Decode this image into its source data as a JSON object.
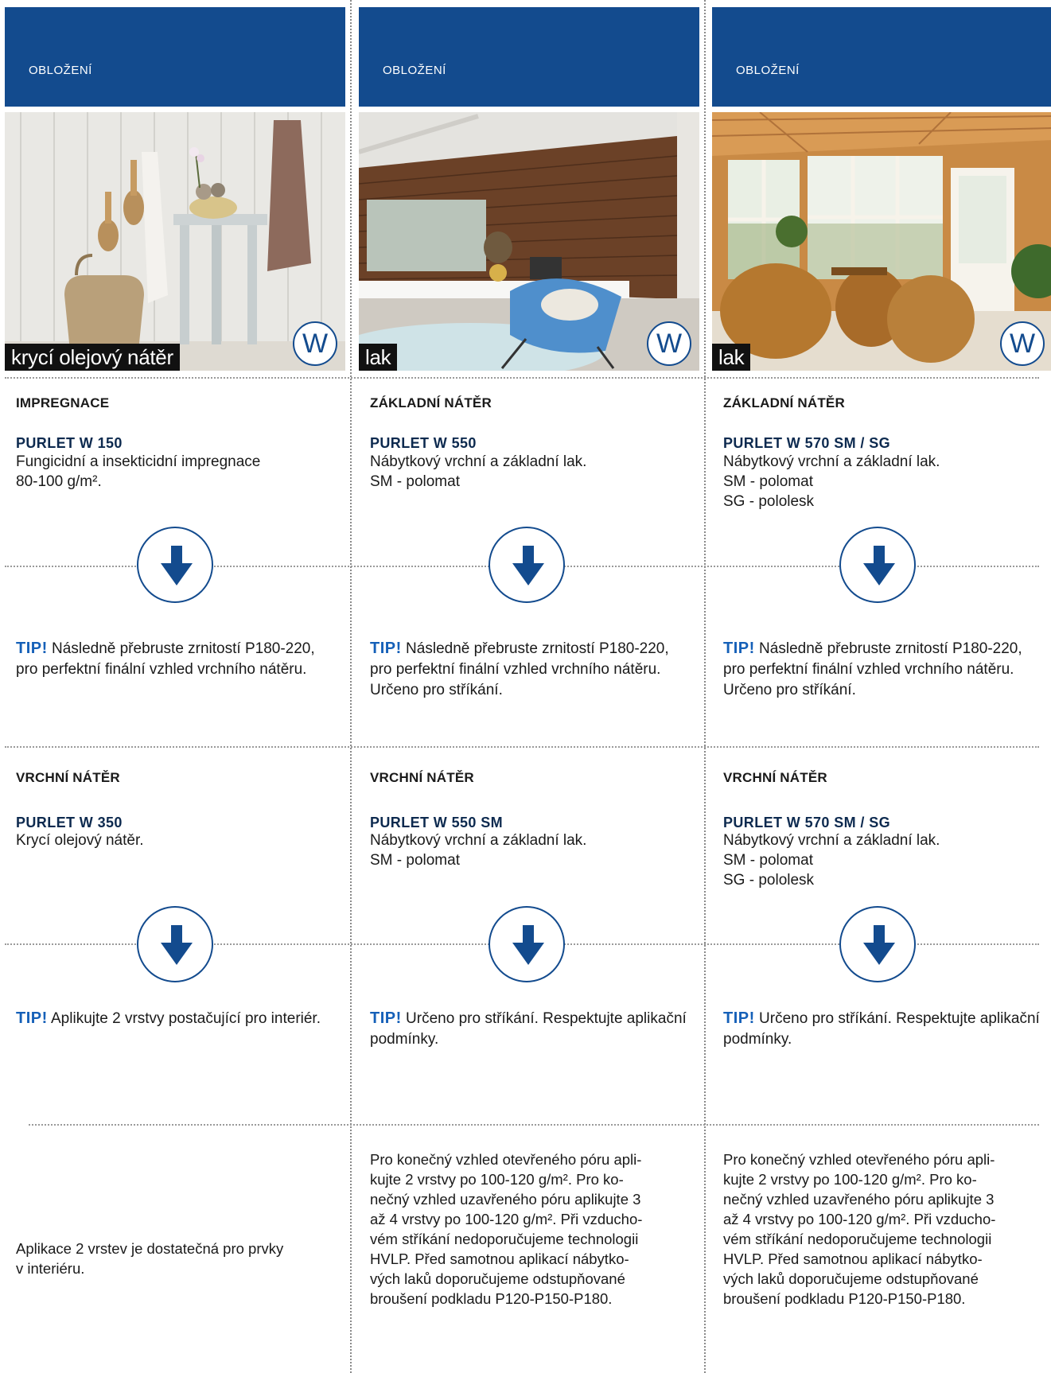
{
  "columns": [
    {
      "header": "OBLOŽENÍ",
      "finish_label": "krycí olejový nátěr",
      "badge": "W",
      "step1": {
        "title": "IMPREGNACE",
        "product": "PURLET W 150",
        "desc": [
          "Fungicidní a insekticidní impregnace",
          "80-100 g/m²."
        ]
      },
      "tip1": {
        "tip_word": "TIP!",
        "text": " Následně přebruste zrnitostí P180-220, pro perfektní finální vzhled vrchního nátěru."
      },
      "step2": {
        "title": "VRCHNÍ NÁTĚR",
        "product": "PURLET W 350",
        "desc": [
          "Krycí olejový  nátěr."
        ]
      },
      "tip2": {
        "tip_word": "TIP!",
        "text": " Aplikujte 2 vrstvy postačující pro interiér."
      },
      "final": [
        "Aplikace 2 vrstev je dostatečná pro prvky",
        "v interiéru."
      ]
    },
    {
      "header": "OBLOŽENÍ",
      "finish_label": "lak",
      "badge": "W",
      "step1": {
        "title": "ZÁKLADNÍ NÁTĚR",
        "product": "PURLET W 550",
        "desc": [
          "Nábytkový vrchní a základní lak.",
          "SM - polomat"
        ]
      },
      "tip1": {
        "tip_word": "TIP!",
        "text": " Následně přebruste zrnitostí P180-220, pro perfektní finální vzhled vrchního nátěru. Určeno pro stříkání."
      },
      "step2": {
        "title": "VRCHNÍ NÁTĚR",
        "product": "PURLET W 550 SM",
        "desc": [
          "Nábytkový vrchní a základní lak.",
          "SM - polomat"
        ]
      },
      "tip2": {
        "tip_word": "TIP!",
        "text": " Určeno pro stříkání. Respektujte aplikační podmínky."
      },
      "final": [
        "Pro konečný vzhled otevřeného póru apli-",
        "kujte 2 vrstvy po 100-120 g/m². Pro ko-",
        "nečný vzhled uzavřeného póru aplikujte 3",
        "až 4 vrstvy po 100-120 g/m². Při vzducho-",
        "vém stříkání nedoporučujeme technologii",
        "HVLP. Před samotnou aplikací nábytko-",
        "vých laků doporučujeme odstupňované",
        "broušení podkladu P120-P150-P180."
      ]
    },
    {
      "header": "OBLOŽENÍ",
      "finish_label": "lak",
      "badge": "W",
      "step1": {
        "title": "ZÁKLADNÍ NÁTĚR",
        "product": "PURLET W 570 SM / SG",
        "desc": [
          "Nábytkový vrchní a základní lak.",
          "SM -  polomat",
          "SG - pololesk"
        ]
      },
      "tip1": {
        "tip_word": "TIP!",
        "text": " Následně přebruste zrnitostí P180-220, pro perfektní finální vzhled vrchního nátěru. Určeno pro stříkání."
      },
      "step2": {
        "title": "VRCHNÍ NÁTĚR",
        "product": "PURLET W 570 SM / SG",
        "desc": [
          "Nábytkový vrchní a základní lak.",
          "SM -  polomat",
          "SG - pololesk"
        ]
      },
      "tip2": {
        "tip_word": "TIP!",
        "text": " Určeno pro stříkání. Respektujte aplikační podmínky."
      },
      "final": [
        "Pro konečný vzhled otevřeného póru apli-",
        "kujte 2 vrstvy po 100-120 g/m². Pro ko-",
        "nečný vzhled uzavřeného póru aplikujte 3",
        "až 4 vrstvy po 100-120 g/m². Při vzducho-",
        "vém stříkání nedoporučujeme technologii",
        "HVLP. Před samotnou aplikací nábytko-",
        "vých laků doporučujeme odstupňované",
        "broušení podkladu P120-P150-P180."
      ]
    }
  ],
  "colors": {
    "header_blue": "#134b8e",
    "tip_blue": "#1560b8",
    "arrow_blue": "#134b8e"
  }
}
